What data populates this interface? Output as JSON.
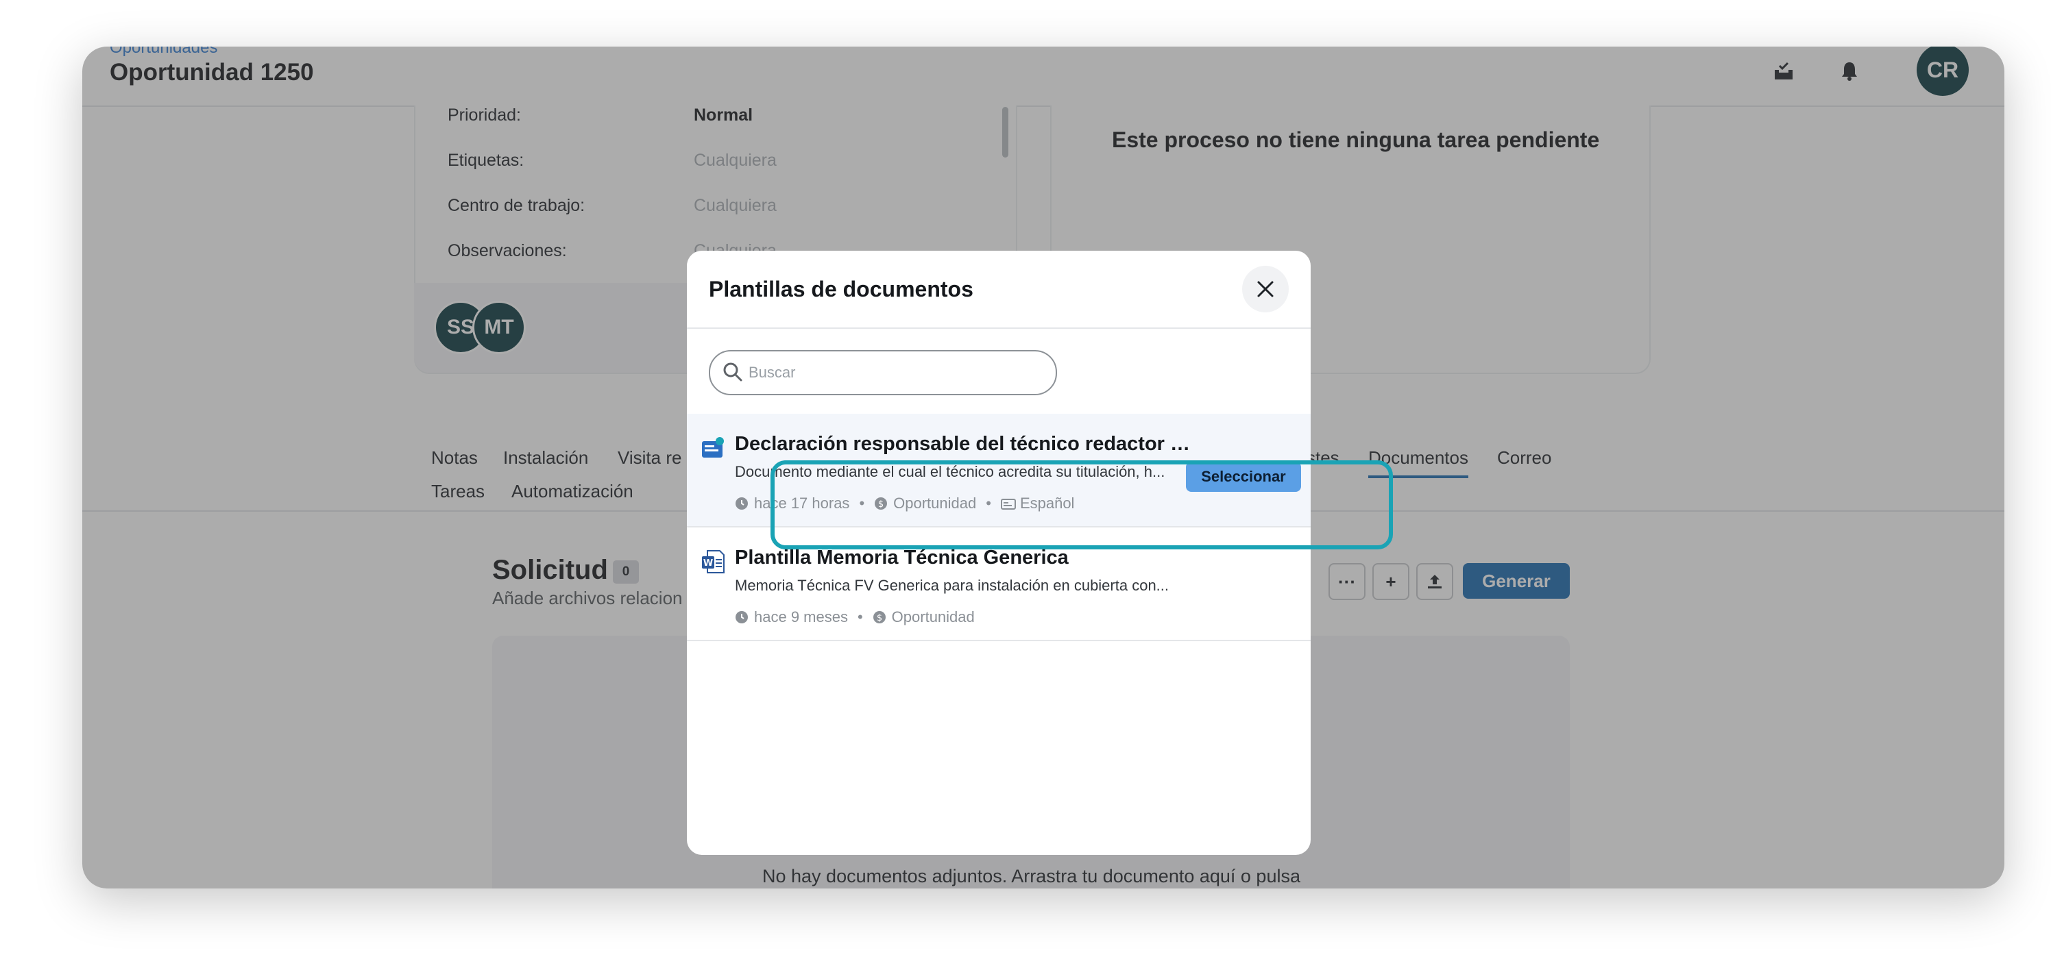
{
  "header": {
    "breadcrumb": "Oportunidades",
    "title": "Oportunidad 1250",
    "user_initials": "CR"
  },
  "details": {
    "fields": [
      {
        "label": "Prioridad:",
        "value": "Normal"
      },
      {
        "label": "Etiquetas:",
        "value": "Cualquiera"
      },
      {
        "label": "Centro de trabajo:",
        "value": "Cualquiera"
      },
      {
        "label": "Observaciones:",
        "value": "Cualquiera"
      }
    ],
    "participants": [
      "SS",
      "MT"
    ]
  },
  "tasks": {
    "empty_text": "Este proceso no tiene ninguna tarea pendiente"
  },
  "tabs": {
    "row1": [
      "Notas",
      "Instalación",
      "Visita re",
      "stes",
      "Documentos",
      "Correo"
    ],
    "row2": [
      "Tareas",
      "Automatización"
    ],
    "active": "Documentos"
  },
  "section": {
    "title": "Solicitud",
    "count": "0",
    "subtitle": "Añade archivos relacion",
    "more_label": "···",
    "add_label": "+",
    "generate_label": "Generar",
    "empty_text": "No hay documentos adjuntos. Arrastra tu documento aquí o pulsa"
  },
  "modal": {
    "title": "Plantillas de documentos",
    "search_placeholder": "Buscar",
    "templates": [
      {
        "title": "Declaración responsable del técnico redactor m...",
        "description": "Documento mediante el cual el técnico acredita su titulación, h...",
        "time": "hace 17 horas",
        "entity": "Oportunidad",
        "language": "Español",
        "action_label": "Seleccionar"
      },
      {
        "title": "Plantilla Memoria Técnica Generica",
        "description": "Memoria Técnica FV Generica para instalación en cubierta con...",
        "time": "hace 9 meses",
        "entity": "Oportunidad"
      }
    ]
  },
  "colors": {
    "accent": "#1a6ab0",
    "highlight": "#1aa3b5",
    "avatar": "#0b3a40"
  }
}
